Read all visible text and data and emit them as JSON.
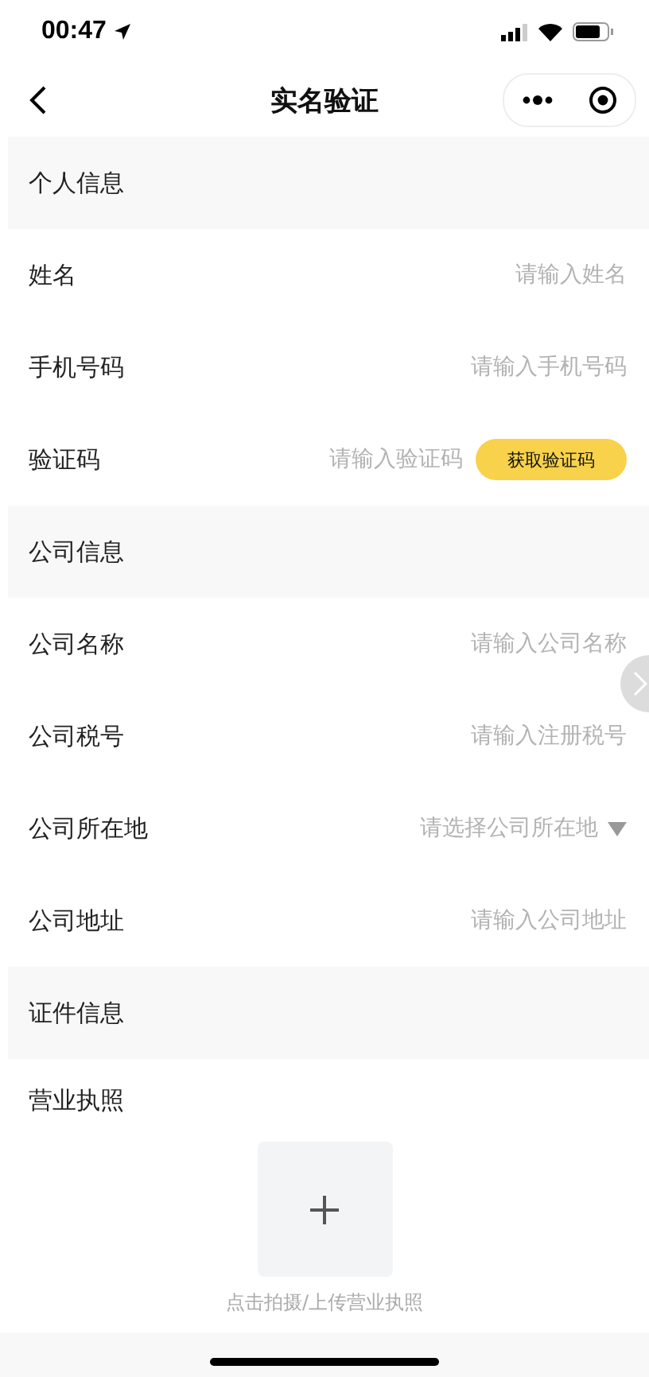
{
  "status_bar": {
    "time": "00:47"
  },
  "nav": {
    "title": "实名验证"
  },
  "sections": [
    {
      "title": "个人信息",
      "fields": [
        {
          "kind": "input",
          "label": "姓名",
          "placeholder": "请输入姓名"
        },
        {
          "kind": "input",
          "label": "手机号码",
          "placeholder": "请输入手机号码"
        },
        {
          "kind": "code",
          "label": "验证码",
          "placeholder": "请输入验证码",
          "button": "获取验证码"
        }
      ]
    },
    {
      "title": "公司信息",
      "fields": [
        {
          "kind": "input",
          "label": "公司名称",
          "placeholder": "请输入公司名称"
        },
        {
          "kind": "input",
          "label": "公司税号",
          "placeholder": "请输入注册税号"
        },
        {
          "kind": "select",
          "label": "公司所在地",
          "placeholder": "请选择公司所在地"
        },
        {
          "kind": "input",
          "label": "公司地址",
          "placeholder": "请输入公司地址"
        }
      ]
    },
    {
      "title": "证件信息",
      "fields": [
        {
          "kind": "upload",
          "label": "营业执照",
          "caption": "点击拍摄/上传营业执照"
        }
      ]
    }
  ]
}
